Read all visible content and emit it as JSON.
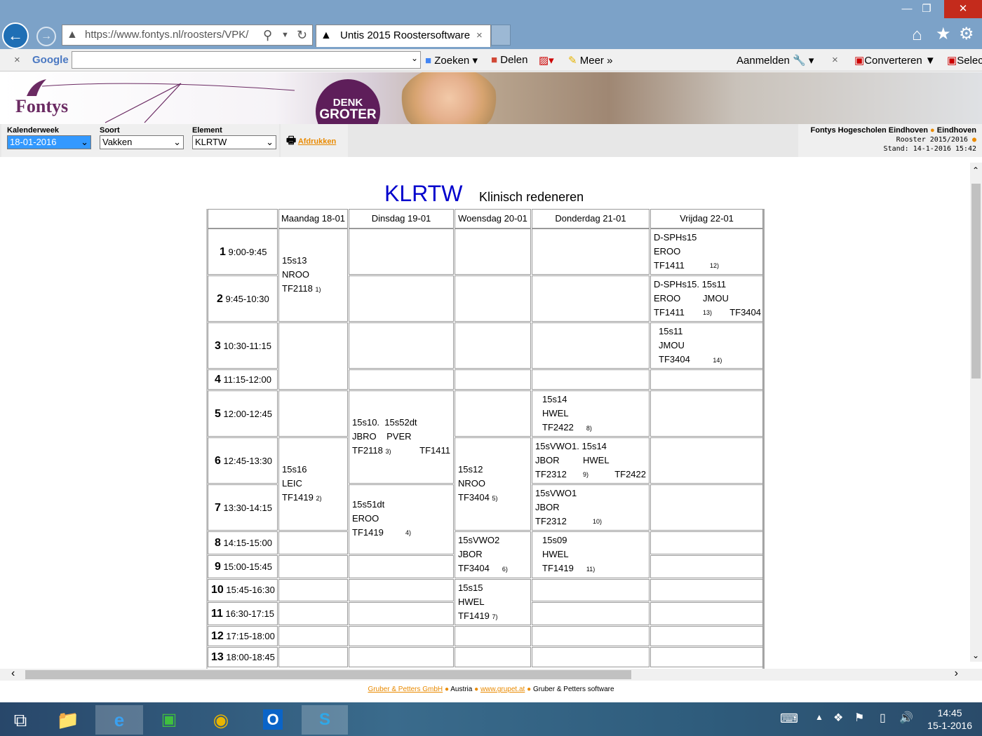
{
  "browser": {
    "url": "https://www.fontys.nl/roosters/VPK/",
    "tab_title": "Untis 2015 Roostersoftware",
    "tab_close": "×",
    "google_label": "Google",
    "search_label": "Zoeken",
    "share_label": "Delen",
    "more_label": "Meer",
    "signin_label": "Aanmelden",
    "convert_label": "Converteren",
    "select_label": "Selec"
  },
  "banner": {
    "logo_text": "Fontys",
    "denk": "DENK",
    "groter": "GROTER"
  },
  "toolbar": {
    "week_label": "Kalenderweek",
    "week_value": "18-01-2016",
    "soort_label": "Soort",
    "soort_value": "Vakken",
    "element_label": "Element",
    "element_value": "KLRTW",
    "print_label": "Afdrukken",
    "school_name": "Fontys Hogescholen Eindhoven",
    "school_city": "Eindhoven",
    "rooster": "Rooster 2015/2016",
    "stand": "Stand: 14-1-2016 15:42"
  },
  "schedule": {
    "code": "KLRTW",
    "name": "Klinisch redeneren",
    "days": [
      "Maandag 18-01",
      "Dinsdag 19-01",
      "Woensdag 20-01",
      "Donderdag 21-01",
      "Vrijdag 22-01"
    ],
    "slots": [
      {
        "n": "1",
        "time": "9:00-9:45"
      },
      {
        "n": "2",
        "time": "9:45-10:30"
      },
      {
        "n": "3",
        "time": "10:30-11:15"
      },
      {
        "n": "4",
        "time": "11:15-12:00"
      },
      {
        "n": "5",
        "time": "12:00-12:45"
      },
      {
        "n": "6",
        "time": "12:45-13:30"
      },
      {
        "n": "7",
        "time": "13:30-14:15"
      },
      {
        "n": "8",
        "time": "14:15-15:00"
      },
      {
        "n": "9",
        "time": "15:00-15:45"
      },
      {
        "n": "10",
        "time": "15:45-16:30"
      },
      {
        "n": "11",
        "time": "16:30-17:15"
      },
      {
        "n": "12",
        "time": "17:15-18:00"
      },
      {
        "n": "13",
        "time": "18:00-18:45"
      }
    ],
    "lessons": {
      "mon1": {
        "l1": "15s13",
        "l2": "NROO",
        "l3": "TF2118",
        "fn": "1)"
      },
      "mon6": {
        "l1": "15s16",
        "l2": "LEIC",
        "l3": "TF1419",
        "fn": "2)"
      },
      "tue5": {
        "l1a": "15s10.",
        "l1b": "15s52dt",
        "l2a": "JBRO",
        "l2b": "PVER",
        "l3a": "TF2118",
        "fn": "3)",
        "l3b": "TF1411"
      },
      "tue7": {
        "l1": "15s51dt",
        "l2": "EROO",
        "l3": "TF1419",
        "fn": "4)"
      },
      "wed6": {
        "l1": "15s12",
        "l2": "NROO",
        "l3": "TF3404",
        "fn": "5)"
      },
      "wed8": {
        "l1": "15sVWO2",
        "l2": "JBOR",
        "l3": "TF3404",
        "fn": "6)"
      },
      "wed10": {
        "l1": "15s15",
        "l2": "HWEL",
        "l3": "TF1419",
        "fn": "7)"
      },
      "thu5": {
        "l1": "15s14",
        "l2": "HWEL",
        "l3": "TF2422",
        "fn": "8)"
      },
      "thu6": {
        "l1a": "15sVWO1.",
        "l1b": "15s14",
        "l2a": "JBOR",
        "l2b": "HWEL",
        "l3a": "TF2312",
        "fn": "9)",
        "l3b": "TF2422"
      },
      "thu7": {
        "l1": "15sVWO1",
        "l2": "JBOR",
        "l3": "TF2312",
        "fn": "10)"
      },
      "thu8": {
        "l1": "15s09",
        "l2": "HWEL",
        "l3": "TF1419",
        "fn": "11)"
      },
      "fri1": {
        "l1": "D-SPHs15",
        "l2": "EROO",
        "l3": "TF1411",
        "fn": "12)"
      },
      "fri2": {
        "l1a": "D-SPHs15.",
        "l1b": "15s11",
        "l2a": "EROO",
        "l2b": "JMOU",
        "l3a": "TF1411",
        "fn": "13)",
        "l3b": "TF3404"
      },
      "fri3": {
        "l1": "15s11",
        "l2": "JMOU",
        "l3": "TF3404",
        "fn": "14)"
      }
    }
  },
  "footer": {
    "company": "Gruber & Petters GmbH",
    "country": "Austria",
    "website": "www.grupet.at",
    "software": "Gruber & Petters software"
  },
  "taskbar": {
    "time": "14:45",
    "date": "15-1-2016"
  },
  "colors": {
    "title_blue": "#0000cc",
    "link_orange": "#e98a00",
    "fontys_purple": "#6b2b63",
    "browser_chrome": "#7ca2c8"
  }
}
